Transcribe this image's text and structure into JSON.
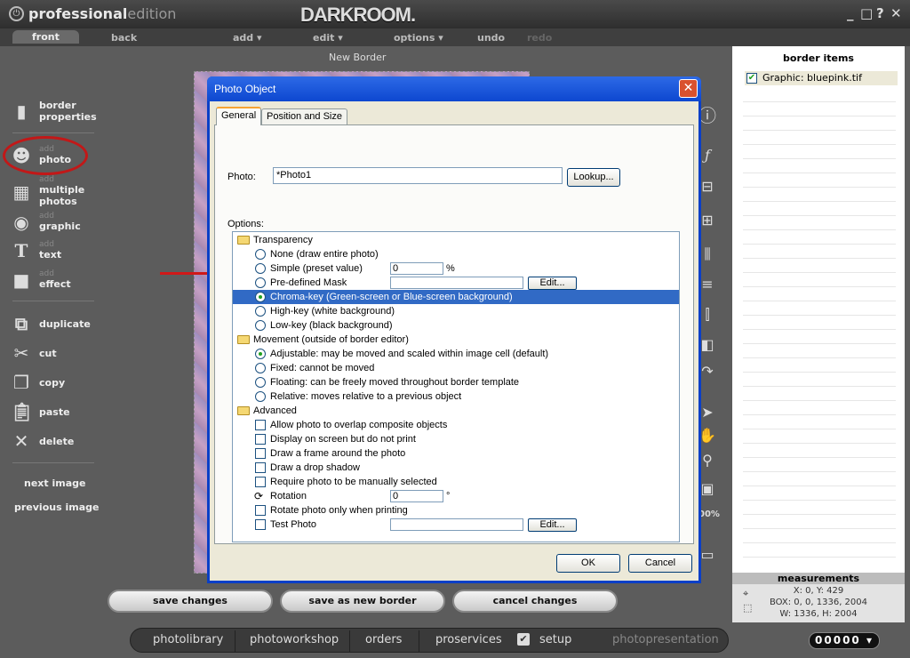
{
  "app": {
    "brand_main": "professional",
    "brand_edition": "edition",
    "logo": "DARKROOM.",
    "window_controls": [
      "_",
      "□",
      "?",
      "✕"
    ]
  },
  "menubar": {
    "items": [
      "front",
      "back",
      "add ▾",
      "edit ▾",
      "options ▾",
      "undo",
      "redo"
    ]
  },
  "canvas": {
    "title": "New Border"
  },
  "sidebar": {
    "items": [
      {
        "small": "",
        "label": "border\nproperties",
        "icon": "page-icon"
      },
      {
        "small": "add",
        "label": "photo",
        "icon": "photo-silhouette-icon"
      },
      {
        "small": "add",
        "label": "multiple\nphotos",
        "icon": "multi-photo-icon"
      },
      {
        "small": "add",
        "label": "graphic",
        "icon": "graphic-icon"
      },
      {
        "small": "add",
        "label": "text",
        "icon": "text-icon"
      },
      {
        "small": "add",
        "label": "effect",
        "icon": "effect-icon"
      },
      {
        "small": "",
        "label": "duplicate",
        "icon": "duplicate-icon"
      },
      {
        "small": "",
        "label": "cut",
        "icon": "scissors-icon"
      },
      {
        "small": "",
        "label": "copy",
        "icon": "copy-icon"
      },
      {
        "small": "",
        "label": "paste",
        "icon": "paste-icon"
      },
      {
        "small": "",
        "label": "delete",
        "icon": "delete-icon"
      }
    ],
    "next_image": "next image",
    "previous_image": "previous image"
  },
  "right_panel": {
    "title": "border items",
    "items": [
      {
        "label": "Graphic: bluepink.tif",
        "checked": true
      }
    ]
  },
  "right_tools": {
    "zoom": "00%"
  },
  "measurements": {
    "title": "measurements",
    "xy": "X: 0, Y: 429",
    "box": "BOX: 0, 0, 1336, 2004",
    "wh": "W: 1336, H: 2004"
  },
  "bottom_buttons": [
    "save changes",
    "save as new border",
    "cancel changes"
  ],
  "bottom_nav": {
    "items": [
      "photolibrary",
      "photoworkshop",
      "orders",
      "proservices",
      "setup",
      "photopresentation"
    ],
    "counter": "00000 ▾"
  },
  "dialog": {
    "title": "Photo Object",
    "tabs": [
      "General",
      "Position and Size"
    ],
    "photo_label": "Photo:",
    "photo_value": "*Photo1",
    "lookup_button": "Lookup...",
    "options_label": "Options:",
    "groups": {
      "transparency": "Transparency",
      "movement": "Movement  (outside of border editor)",
      "advanced": "Advanced"
    },
    "transparency_options": [
      "None  (draw entire photo)",
      "Simple (preset value)",
      "Pre-defined Mask",
      "Chroma-key (Green-screen or Blue-screen background)",
      "High-key (white background)",
      "Low-key (black background)"
    ],
    "simple_value": "0",
    "simple_unit": "%",
    "edit_button": "Edit...",
    "movement_options": [
      "Adjustable:  may be moved and scaled within image cell (default)",
      "Fixed:  cannot be moved",
      "Floating:  can be freely moved throughout border template",
      "Relative:  moves relative to a previous object"
    ],
    "advanced_options": [
      "Allow photo to overlap composite objects",
      "Display on screen but do not print",
      "Draw a frame around the photo",
      "Draw a drop shadow",
      "Require photo to be manually selected",
      "Rotation",
      "Rotate photo only when printing",
      "Test Photo"
    ],
    "rotation_value": "0",
    "rotation_unit": "°",
    "ok_button": "OK",
    "cancel_button": "Cancel"
  }
}
